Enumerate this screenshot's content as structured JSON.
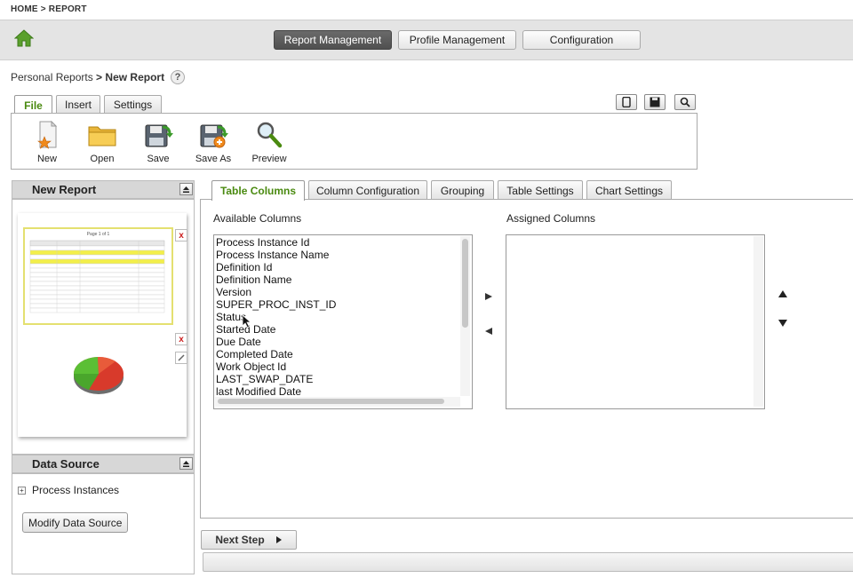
{
  "top_breadcrumb": "HOME > REPORT",
  "nav": {
    "report_management": "Report Management",
    "profile_management": "Profile Management",
    "configuration": "Configuration"
  },
  "page_breadcrumb": {
    "parent": "Personal Reports",
    "separator": " > ",
    "current": "New Report",
    "help": "?"
  },
  "file_tabs": [
    "File",
    "Insert",
    "Settings"
  ],
  "toolbar": {
    "new": "New",
    "open": "Open",
    "save": "Save",
    "save_as": "Save As",
    "preview": "Preview"
  },
  "left_panel": {
    "title": "New Report",
    "thumbnail_pager": "Page 1 of 1"
  },
  "data_source": {
    "title": "Data Source",
    "tree_item": "Process Instances",
    "modify_button": "Modify Data Source"
  },
  "config_tabs": [
    "Table Columns",
    "Column Configuration",
    "Grouping",
    "Table Settings",
    "Chart Settings"
  ],
  "available": {
    "label": "Available Columns",
    "items": [
      "Process Instance Id",
      "Process Instance Name",
      "Definition Id",
      "Definition Name",
      "Version",
      "SUPER_PROC_INST_ID",
      "Status",
      "Started Date",
      "Due Date",
      "Completed Date",
      "Work Object Id",
      "LAST_SWAP_DATE",
      "last Modified Date"
    ]
  },
  "assigned": {
    "label": "Assigned Columns",
    "items": []
  },
  "next_step": "Next Step",
  "colors": {
    "accent_green": "#4a8a10",
    "active_nav": "#5a5a5a"
  }
}
